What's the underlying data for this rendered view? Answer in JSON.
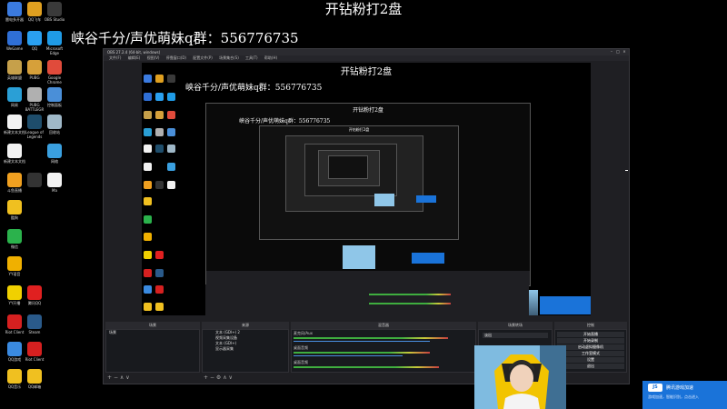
{
  "overlay": {
    "title": "开钻粉打2盘",
    "qq_group": "峡谷千分/声优萌妹q群：556776735"
  },
  "desktop": {
    "icons": [
      {
        "label": "雷电多开器",
        "color": "#3b7be0",
        "icon": "app-icon"
      },
      {
        "label": "QQ飞车",
        "color": "#e0a020",
        "icon": "car-icon"
      },
      {
        "label": "OBS Studio",
        "color": "#3a3a3a",
        "icon": "obs-icon"
      },
      {
        "label": "WeGame",
        "color": "#2f6fd6",
        "icon": "wegame-icon"
      },
      {
        "label": "QQ",
        "color": "#2aa0f0",
        "icon": "qq-icon"
      },
      {
        "label": "Microsoft Edge",
        "color": "#1f9be6",
        "icon": "edge-icon"
      },
      {
        "label": "英雄联盟",
        "color": "#c6a04a",
        "icon": "lol-icon"
      },
      {
        "label": "PUBG",
        "color": "#d6a03a",
        "icon": "pubg-icon"
      },
      {
        "label": "Google Chrome",
        "color": "#e04b3b",
        "icon": "chrome-icon"
      },
      {
        "label": "网易",
        "color": "#2a9fd6",
        "icon": "app-icon"
      },
      {
        "label": "PUBG BATTLEGR",
        "color": "#b0b0b0",
        "icon": "pubg-icon"
      },
      {
        "label": "控制面板",
        "color": "#4a8fd8",
        "icon": "control-panel-icon"
      },
      {
        "label": "新建文本文档",
        "color": "#f2f2f2",
        "icon": "text-file-icon"
      },
      {
        "label": "League of Legends",
        "color": "#1e4d6b",
        "icon": "lol-icon"
      },
      {
        "label": "回收站",
        "color": "#9fb8c8",
        "icon": "recycle-bin-icon"
      },
      {
        "label": "新建文本文档",
        "color": "#f2f2f2",
        "icon": "text-file-icon"
      },
      {
        "label": "网络",
        "color": "#3aa0e0",
        "icon": "network-icon"
      },
      {
        "label": "斗鱼直播",
        "color": "#f0a020",
        "icon": "douyu-icon"
      },
      {
        "label": "",
        "color": "#333333",
        "icon": "app-icon"
      },
      {
        "label": "Ma",
        "color": "#f2f2f2",
        "icon": "text-file-icon"
      },
      {
        "label": "酷狗",
        "color": "#f0c020",
        "icon": "app-icon"
      },
      {
        "label": "微信",
        "color": "#2bb24c",
        "icon": "wechat-icon"
      },
      {
        "label": "YY语音",
        "color": "#f0b000",
        "icon": "yy-icon"
      },
      {
        "label": "YY开播",
        "color": "#f0d000",
        "icon": "yy-icon"
      },
      {
        "label": "腾讯QQ",
        "color": "#e02020",
        "icon": "qq-icon"
      },
      {
        "label": "Riot Client",
        "color": "#d62020",
        "icon": "riot-icon"
      },
      {
        "label": "Steam",
        "color": "#2a5a8a",
        "icon": "steam-icon"
      },
      {
        "label": "QQ游戏",
        "color": "#3a8ae0",
        "icon": "app-icon"
      },
      {
        "label": "Riot Client",
        "color": "#d62020",
        "icon": "riot-icon"
      },
      {
        "label": "QQ音乐",
        "color": "#f0c020",
        "icon": "app-icon"
      },
      {
        "label": "QQ邮箱",
        "color": "#f0c020",
        "icon": "app-icon"
      }
    ]
  },
  "obs": {
    "title": "OBS 27.2.4 (64-bit, windows)",
    "menu": [
      "文件(F)",
      "编辑(E)",
      "视图(V)",
      "停靠窗口(D)",
      "配置文件(P)",
      "场景集合(S)",
      "工具(T)",
      "帮助(H)"
    ],
    "docks": {
      "scenes_title": "场景",
      "sources_title": "来源",
      "mixer_title": "混音器",
      "transitions_title": "场景转场",
      "controls_title": "控制",
      "scene_item": "场景",
      "sources": [
        "文本 (GDI+) 2",
        "视频采集设备",
        "文本 (GDI+)",
        "显示器采集"
      ],
      "mixer_tracks": [
        "麦克风/Aux",
        "桌面音频",
        "桌面音频"
      ],
      "transition_value": "淡出",
      "controls": [
        "开始直播",
        "开始录制",
        "启动虚拟摄像机",
        "工作室模式",
        "设置",
        "退出"
      ]
    }
  },
  "notification": {
    "title": "腾讯游戏加速",
    "body": "游戏加速，智能识别，点击进入"
  },
  "colors": {
    "accent_blue": "#4a90e2",
    "notification": "#1a73d9",
    "meter_green": "#3fae3f"
  }
}
